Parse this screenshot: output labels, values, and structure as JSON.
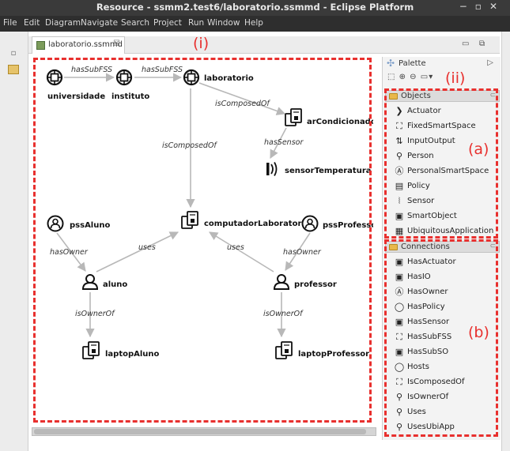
{
  "window": {
    "title": "Resource - ssmm2.test6/laboratorio.ssmmd - Eclipse Platform",
    "minimize": "−",
    "maximize": "▫",
    "close": "✕"
  },
  "menu": [
    "File",
    "Edit",
    "Diagram",
    "Navigate",
    "Search",
    "Project",
    "Run",
    "Window",
    "Help"
  ],
  "editor_tab": {
    "label": "laboratorio.ssmmd",
    "close": "☒"
  },
  "editor_controls": {
    "minimize": "▭",
    "maximize": "⧉"
  },
  "annotations": {
    "canvas": "(i)",
    "palette": "(ii)",
    "objects": "(a)",
    "connections": "(b)"
  },
  "diagram": {
    "nodes": [
      {
        "id": "universidade",
        "label": "universidade",
        "icon": "fixed-smart-space-icon"
      },
      {
        "id": "instituto",
        "label": "instituto",
        "icon": "fixed-smart-space-icon"
      },
      {
        "id": "laboratorio",
        "label": "laboratorio",
        "icon": "fixed-smart-space-icon"
      },
      {
        "id": "arCondicionado",
        "label": "arCondicionado",
        "icon": "smart-object-icon"
      },
      {
        "id": "sensorTemperatura",
        "label": "sensorTemperatura",
        "icon": "sensor-icon"
      },
      {
        "id": "computadorLaboratorio",
        "label": "computadorLaboratorio",
        "icon": "smart-object-icon"
      },
      {
        "id": "pssAluno",
        "label": "pssAluno",
        "icon": "personal-smart-space-icon"
      },
      {
        "id": "pssProfessor",
        "label": "pssProfessor",
        "icon": "personal-smart-space-icon"
      },
      {
        "id": "aluno",
        "label": "aluno",
        "icon": "person-icon"
      },
      {
        "id": "professor",
        "label": "professor",
        "icon": "person-icon"
      },
      {
        "id": "laptopAluno",
        "label": "laptopAluno",
        "icon": "smart-object-icon"
      },
      {
        "id": "laptopProfessor",
        "label": "laptopProfessor",
        "icon": "smart-object-icon"
      }
    ],
    "edges": [
      {
        "from": "universidade",
        "to": "instituto",
        "label": "hasSubFSS"
      },
      {
        "from": "instituto",
        "to": "laboratorio",
        "label": "hasSubFSS"
      },
      {
        "from": "laboratorio",
        "to": "arCondicionado",
        "label": "isComposedOf"
      },
      {
        "from": "arCondicionado",
        "to": "sensorTemperatura",
        "label": "hasSensor"
      },
      {
        "from": "laboratorio",
        "to": "computadorLaboratorio",
        "label": "isComposedOf"
      },
      {
        "from": "pssAluno",
        "to": "aluno",
        "label": "hasOwner"
      },
      {
        "from": "pssProfessor",
        "to": "professor",
        "label": "hasOwner"
      },
      {
        "from": "aluno",
        "to": "computadorLaboratorio",
        "label": "uses"
      },
      {
        "from": "professor",
        "to": "computadorLaboratorio",
        "label": "uses"
      },
      {
        "from": "aluno",
        "to": "laptopAluno",
        "label": "isOwnerOf"
      },
      {
        "from": "professor",
        "to": "laptopProfessor",
        "label": "isOwnerOf"
      }
    ]
  },
  "palette": {
    "title": "Palette",
    "collapse": "▷",
    "tools": "⬚ ⊕ ⊖ ▭▾",
    "objects_drawer": {
      "title": "Objects",
      "items": [
        {
          "label": "Actuator",
          "icon": "actuator-icon",
          "glyph": "❯"
        },
        {
          "label": "FixedSmartSpace",
          "icon": "fixed-smart-space-icon",
          "glyph": "⛶"
        },
        {
          "label": "InputOutput",
          "icon": "input-output-icon",
          "glyph": "⇅"
        },
        {
          "label": "Person",
          "icon": "person-icon",
          "glyph": "⚲"
        },
        {
          "label": "PersonalSmartSpace",
          "icon": "personal-smart-space-icon",
          "glyph": "Ⓐ"
        },
        {
          "label": "Policy",
          "icon": "policy-icon",
          "glyph": "▤"
        },
        {
          "label": "Sensor",
          "icon": "sensor-icon",
          "glyph": "⦚"
        },
        {
          "label": "SmartObject",
          "icon": "smart-object-icon",
          "glyph": "▣"
        },
        {
          "label": "UbiquitousApplication",
          "icon": "ubiquitous-application-icon",
          "glyph": "▦"
        }
      ]
    },
    "connections_drawer": {
      "title": "Connections",
      "items": [
        {
          "label": "HasActuator",
          "icon": "has-actuator-icon",
          "glyph": "▣"
        },
        {
          "label": "HasIO",
          "icon": "has-io-icon",
          "glyph": "▣"
        },
        {
          "label": "HasOwner",
          "icon": "has-owner-icon",
          "glyph": "Ⓐ"
        },
        {
          "label": "HasPolicy",
          "icon": "has-policy-icon",
          "glyph": "◯"
        },
        {
          "label": "HasSensor",
          "icon": "has-sensor-icon",
          "glyph": "▣"
        },
        {
          "label": "HasSubFSS",
          "icon": "has-sub-fss-icon",
          "glyph": "⛶"
        },
        {
          "label": "HasSubSO",
          "icon": "has-sub-so-icon",
          "glyph": "▣"
        },
        {
          "label": "Hosts",
          "icon": "hosts-icon",
          "glyph": "◯"
        },
        {
          "label": "IsComposedOf",
          "icon": "is-composed-of-icon",
          "glyph": "⛶"
        },
        {
          "label": "IsOwnerOf",
          "icon": "is-owner-of-icon",
          "glyph": "⚲"
        },
        {
          "label": "Uses",
          "icon": "uses-icon",
          "glyph": "⚲"
        },
        {
          "label": "UsesUbiApp",
          "icon": "uses-ubi-app-icon",
          "glyph": "⚲"
        }
      ]
    }
  },
  "colors": {
    "annotation_red": "#e8302e",
    "edge_gray": "#b8b8b8",
    "node_black": "#111111"
  }
}
